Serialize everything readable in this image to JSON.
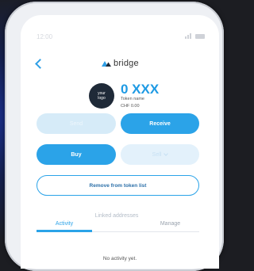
{
  "status_bar": {
    "time": "12:00"
  },
  "header": {
    "brand": "bridge"
  },
  "token": {
    "logo_text": "your\nlogo",
    "amount": "0 XXX",
    "name": "Token name",
    "fiat": "CHF 0.00"
  },
  "actions": {
    "send": "Send",
    "receive": "Receive",
    "buy": "Buy",
    "sell": "Sell",
    "remove": "Remove from token list"
  },
  "tabs": {
    "activity": "Activity",
    "linked": "Linked addresses",
    "manage": "Manage"
  },
  "activity": {
    "empty": "No activity yet."
  },
  "colors": {
    "accent": "#2ba3e8",
    "dark": "#1f2a38"
  }
}
